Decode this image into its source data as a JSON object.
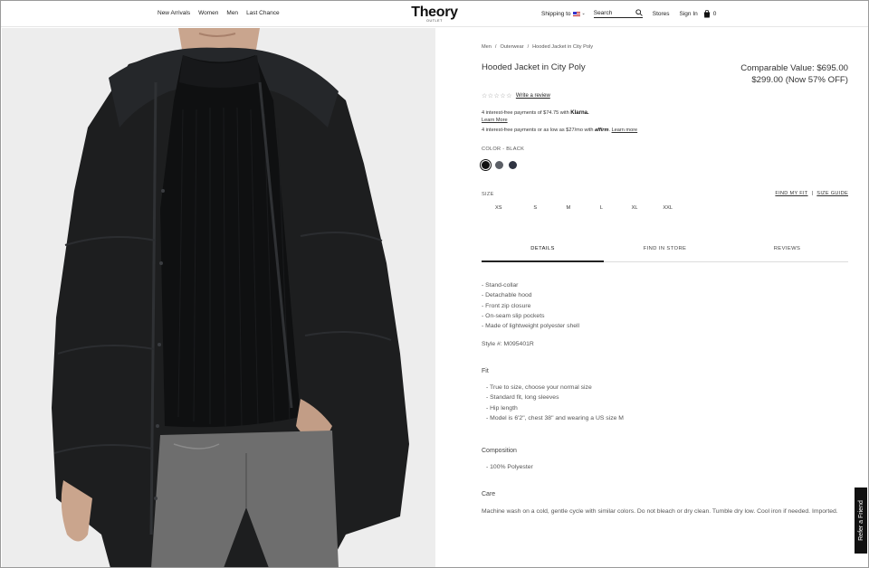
{
  "header": {
    "nav_left": [
      "New Arrivals",
      "Women",
      "Men",
      "Last Chance"
    ],
    "logo": "Theory",
    "logo_sub": "OUTLET",
    "shipping_label": "Shipping to",
    "search_placeholder": "Search",
    "stores": "Stores",
    "sign_in": "Sign In",
    "bag_count": "0"
  },
  "breadcrumb": [
    "Men",
    "/",
    "Outerwear",
    "/",
    "Hooded Jacket in City Poly"
  ],
  "product": {
    "title": "Hooded Jacket in City Poly",
    "comparable": "Comparable Value: $695.00",
    "sale": "$299.00 (Now 57% OFF)",
    "stars": "☆☆☆☆☆",
    "review_link": "Write a review",
    "klarna_text": "4 interest-free payments of $74.75 with",
    "klarna_brand": "Klarna.",
    "klarna_learn": "Learn More",
    "affirm_text": "4 interest-free payments or as low as $27/mo with",
    "affirm_brand": "affirm",
    "affirm_learn": "Learn more",
    "color_label": "COLOR - BLACK",
    "swatches": [
      "#111111",
      "#5b5f66",
      "#2f3442"
    ],
    "size_label": "SIZE",
    "find_fit": "FIND MY FIT",
    "separator": "|",
    "size_guide": "SIZE GUIDE",
    "sizes": [
      "XS",
      "S",
      "M",
      "L",
      "XL",
      "XXL"
    ]
  },
  "tabs": [
    "DETAILS",
    "FIND IN STORE",
    "REVIEWS"
  ],
  "details": {
    "bullets": [
      "- Stand-collar",
      "- Detachable hood",
      "- Front zip closure",
      "- On-seam slip pockets",
      "- Made of lightweight polyester shell"
    ],
    "style_no": "Style #: M095401R",
    "fit_heading": "Fit",
    "fit_items": [
      "- True to size, choose your normal size",
      "- Standard fit, long sleeves",
      "- Hip length",
      "- Model is 6'2\", chest 38\" and wearing a US size M"
    ],
    "composition_heading": "Composition",
    "composition": "- 100% Polyester",
    "care_heading": "Care",
    "care": "Machine wash on a cold, gentle cycle with similar colors. Do not bleach or dry clean. Tumble dry low. Cool iron if needed. Imported."
  },
  "refer_friend": "Refer a Friend",
  "image_subject": "model-in-black-hooded-puffer-jacket"
}
